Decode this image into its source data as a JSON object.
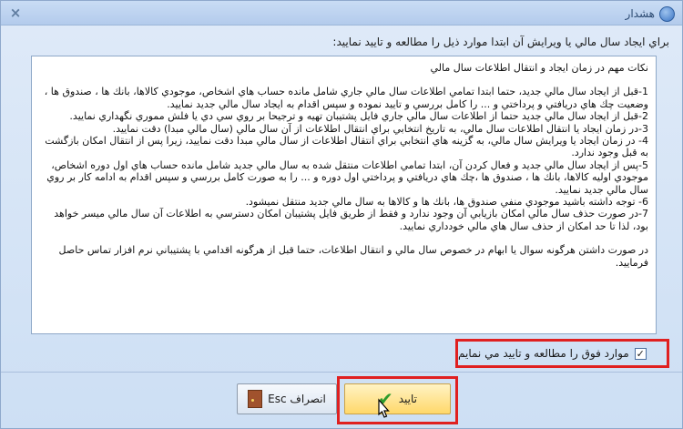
{
  "window": {
    "title": "هشدار",
    "close_glyph": "×"
  },
  "header": {
    "text": "براي ايجاد سال مالي يا ويرايش آن ابتدا موارد ذيل را مطالعه و تاييد نماييد:"
  },
  "content": {
    "title": "نكات مهم در زمان ايجاد و انتقال اطلاعات سال مالي",
    "items": [
      "1-قبل از ايجاد سال مالي جديد، حتما ابتدا تمامي اطلاعات سال مالي جاري شامل مانده حساب هاي اشخاص، موجودي كالاها، بانك ها ، صندوق ها ، وضعيت چك هاي دريافتي و پرداختي و ... را كامل بررسي و تاييد نموده و سپس اقدام به ايجاد سال مالي جديد نماييد.",
      "2-قبل از ايجاد سال مالي جديد حتما از اطلاعات سال مالي جاري فايل پشتيبان تهيه و ترجيحا بر روي سي دي يا فلش مموري نگهداري نماييد.",
      "3-در زمان ايجاد يا انتقال اطلاعات سال مالي، به تاريخ انتخابي براي انتقال اطلاعات از آن سال مالي (سال مالي مبدا) دقت نماييد.",
      "4- در زمان ايجاد يا ويرايش سال مالي، به گزينه هاي انتخابي براي انتقال اطلاعات از سال مالي مبدا دقت نماييد، زيرا پس از انتقال امكان بازگشت به قبل وجود ندارد.",
      "5-پس از ايجاد سال مالي جديد و فعال كردن آن، ابتدا تمامي اطلاعات منتقل شده به سال مالي جديد شامل مانده حساب هاي اول دوره اشخاص، موجودي اوليه كالاها، بانك ها ، صندوق ها ،چك هاي دريافتي و پرداختي اول دوره و ... را به صورت كامل بررسي و سپس اقدام به ادامه كار بر روي سال مالي جديد نماييد.",
      "6- توجه داشته باشيد موجودي منفي صندوق ها، بانك ها و كالاها به سال مالي جديد منتقل نميشود.",
      "7-در صورت حذف سال مالي امكان بازيابي آن وجود ندارد و فقط از طريق فايل پشتيبان امكان دسترسي به اطلاعات آن سال مالي ميسر خواهد بود، لذا تا حد امكان از حذف سال هاي مالي خودداري نماييد."
    ],
    "footer": "در صورت داشتن هرگونه سوال يا ابهام در خصوص سال مالي و انتقال اطلاعات، حتما قبل از هرگونه اقدامي با پشتيباني نرم افزار تماس حاصل فرماييد."
  },
  "agreement": {
    "label": "موارد فوق را مطالعه و تاييد مي نمايم",
    "checked": true,
    "check_glyph": "✓"
  },
  "buttons": {
    "confirm_label": "تاييد",
    "cancel_label": "انصراف Esc"
  },
  "colors": {
    "highlight": "#e02020",
    "confirm_bg": "#ffd86a",
    "check_green": "#2d9b2d"
  },
  "icons": {
    "title": "info-icon",
    "close": "close-icon",
    "confirm": "checkmark-icon",
    "cancel": "door-exit-icon",
    "cursor": "mouse-pointer-icon"
  }
}
